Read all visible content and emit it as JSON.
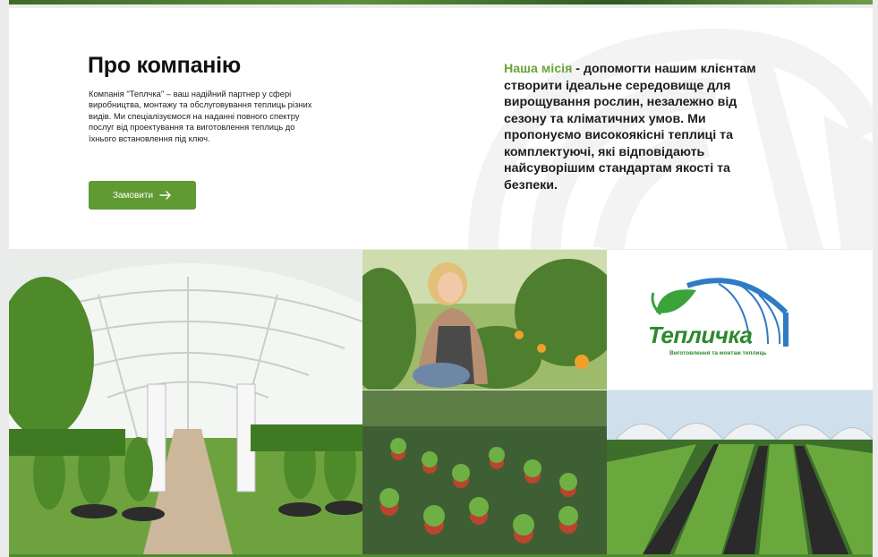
{
  "about": {
    "title": "Про компанію",
    "description": "Компанія \"Теплчка\" – ваш надійний партнер у сфері виробництва, монтажу та обслуговування теплиць різних видів. Ми спеціалізуємося на наданні повного спектру послуг від проектування та виготовлення теплиць до їхнього встановлення під ключ.",
    "order_button": "Замовити",
    "mission_highlight": "Наша місія",
    "mission_text": " - допомогти нашим клієнтам створити ідеальне середовище для вирощування рослин, незалежно від сезону та кліматичних умов. Ми пропонуємо високоякісні теплиці та комплектуючі, які відповідають найсуворішим стандартам якості та безпеки."
  },
  "logo": {
    "name": "Тепличка",
    "tagline": "Виготовлення та монтаж теплиць"
  },
  "colors": {
    "accent": "#6aa436",
    "button": "#5f9a33",
    "logo_blue": "#2f7bc4",
    "logo_green": "#2c8a2c"
  },
  "gallery": [
    "greenhouse-interior",
    "woman-gardener",
    "potted-seedlings",
    "logo",
    "strawberry-greenhouse-field"
  ]
}
